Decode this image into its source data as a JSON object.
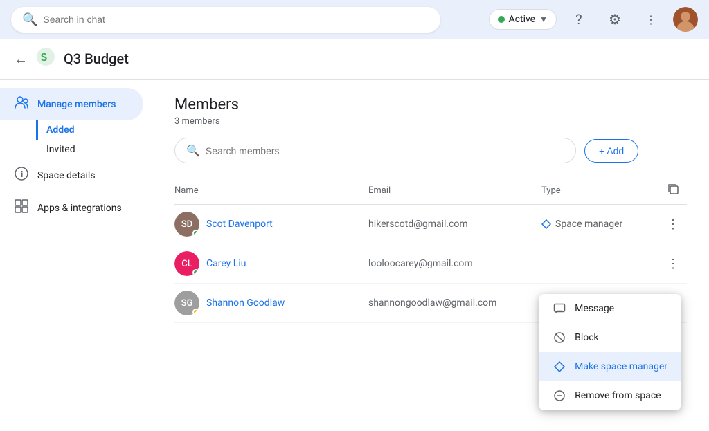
{
  "topbar": {
    "search_placeholder": "Search in chat",
    "status_label": "Active",
    "status_color": "#34a853"
  },
  "space": {
    "title": "Q3 Budget",
    "back_label": "←"
  },
  "sidebar": {
    "manage_members_label": "Manage members",
    "added_label": "Added",
    "invited_label": "Invited",
    "space_details_label": "Space details",
    "apps_integrations_label": "Apps & integrations"
  },
  "members_section": {
    "title": "Members",
    "count": "3 members",
    "search_placeholder": "Search members",
    "add_label": "+ Add"
  },
  "table": {
    "col_name": "Name",
    "col_email": "Email",
    "col_type": "Type",
    "members": [
      {
        "name": "Scot Davenport",
        "email": "hikerscotd@gmail.com",
        "type": "Space manager",
        "status": "online",
        "avatar_bg": "#8d6e63",
        "initials": "SD"
      },
      {
        "name": "Carey Liu",
        "email": "looloocarey@gmail.com",
        "type": "",
        "status": "online",
        "avatar_bg": "#e91e63",
        "initials": "CL"
      },
      {
        "name": "Shannon Goodlaw",
        "email": "shannongoodlaw@gmail.com",
        "type": "",
        "status": "away",
        "avatar_bg": "#9e9e9e",
        "initials": "SG"
      }
    ]
  },
  "context_menu": {
    "message_label": "Message",
    "block_label": "Block",
    "make_manager_label": "Make space manager",
    "remove_label": "Remove from space"
  }
}
